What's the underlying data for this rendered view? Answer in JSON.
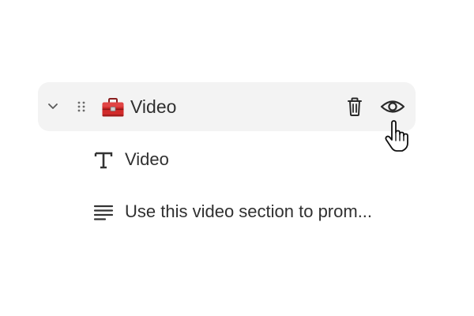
{
  "section": {
    "label": "Video",
    "icon": "toolbox-icon",
    "expanded": true,
    "actions": [
      "delete-icon",
      "eye-icon"
    ]
  },
  "blocks": [
    {
      "icon": "text-heading-icon",
      "label": "Video"
    },
    {
      "icon": "paragraph-icon",
      "label": "Use this video section to prom..."
    }
  ],
  "colors": {
    "row_background": "#f3f3f3",
    "text": "#303030",
    "toolbox_red": "#d12a2a"
  }
}
